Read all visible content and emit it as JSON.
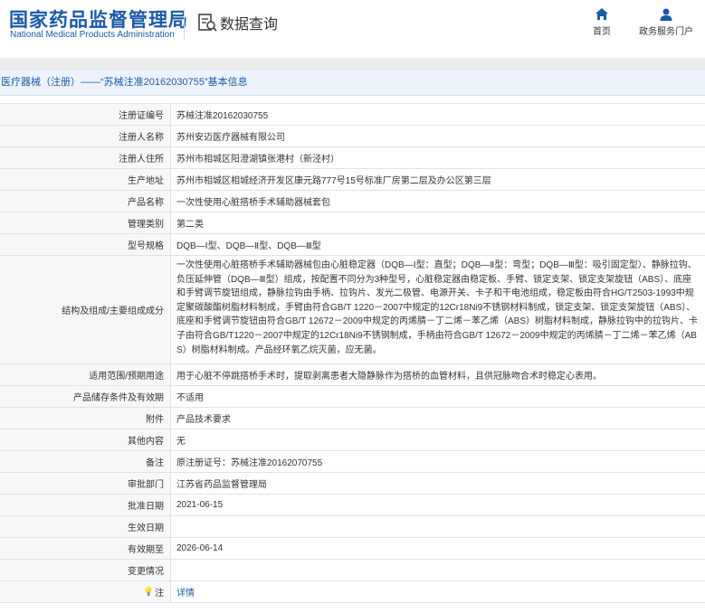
{
  "header": {
    "logo_cn": "国家药品监督管理局",
    "logo_en": "National Medical Products Administration",
    "section_title": "数据查询",
    "nav": [
      {
        "label": "首页",
        "icon": "home-icon"
      },
      {
        "label": "政务服务门户",
        "icon": "user-icon"
      }
    ]
  },
  "title_bar": "医疗器械（注册）——“苏械注准20162030755”基本信息",
  "colors": {
    "brand": "#1b5aa8",
    "label_bg": "#f7f7f7",
    "title_bg": "#eef3fb"
  },
  "rows": [
    {
      "label": "注册证编号",
      "value": "苏械注准20162030755"
    },
    {
      "label": "注册人名称",
      "value": "苏州安迈医疗器械有限公司"
    },
    {
      "label": "注册人住所",
      "value": "苏州市相城区阳澄湖镇张港村（新泾村）"
    },
    {
      "label": "生产地址",
      "value": "苏州市相城区相城经济开发区康元路777号15号标准厂房第二层及办公区第三层"
    },
    {
      "label": "产品名称",
      "value": "一次性使用心脏搭桥手术辅助器械套包"
    },
    {
      "label": "管理类别",
      "value": "第二类"
    },
    {
      "label": "型号规格",
      "value": "DQB—Ⅰ型、DQB—Ⅱ型、DQB—Ⅲ型"
    },
    {
      "label": "结构及组成/主要组成成分",
      "value": "一次性使用心脏搭桥手术辅助器械包由心脏稳定器（DQB—Ⅰ型：直型；DQB—Ⅱ型：弯型；DQB—Ⅲ型：吸引固定型）、静脉拉钩、负压延伸管（DQB—Ⅲ型）组成，按配置不同分为3种型号，心脏稳定器由稳定板、手臂、锁定支架、锁定支架旋钮（ABS）、底座和手臂调节旋钮组成，静脉拉钩由手柄、拉钩片、发光二极管、电源开关、卡子和干电池组成，稳定板由符合HG/T2503-1993中规定聚碳酸酯树脂材料制成，手臂由符合GB/T 1220－2007中规定的12Cr18Ni9不锈钢材料制成，锁定支架、锁定支架旋钮（ABS）、底座和手臂调节旋钮由符合GB/T 12672－2009中规定的丙烯腈－丁二烯－苯乙烯（ABS）树脂材料制成，静脉拉钩中的拉钩片、卡子由符合GB/T1220－2007中规定的12Cr18Ni9不锈钢制成，手柄由符合GB/T 12672－2009中规定的丙烯腈－丁二烯－苯乙烯（ABS）树脂材料制成。产品经环氧乙烷灭菌，应无菌。"
    },
    {
      "label": "适用范围/预期用途",
      "value": "用于心脏不停跳搭桥手术时，提取剥离患者大隐静脉作为搭桥的血管材料，且供冠脉吻合术时稳定心表用。"
    },
    {
      "label": "产品储存条件及有效期",
      "value": "不适用"
    },
    {
      "label": "附件",
      "value": "产品技术要求"
    },
    {
      "label": "其他内容",
      "value": "无"
    },
    {
      "label": "备注",
      "value": "原注册证号：苏械注准20162070755"
    },
    {
      "label": "审批部门",
      "value": "江苏省药品监督管理局"
    },
    {
      "label": "批准日期",
      "value": "2021-06-15"
    },
    {
      "label": "生效日期",
      "value": ""
    },
    {
      "label": "有效期至",
      "value": "2026-06-14"
    },
    {
      "label": "变更情况",
      "value": ""
    },
    {
      "label": "注",
      "value": "详情",
      "icon": "lightbulb-icon"
    }
  ]
}
